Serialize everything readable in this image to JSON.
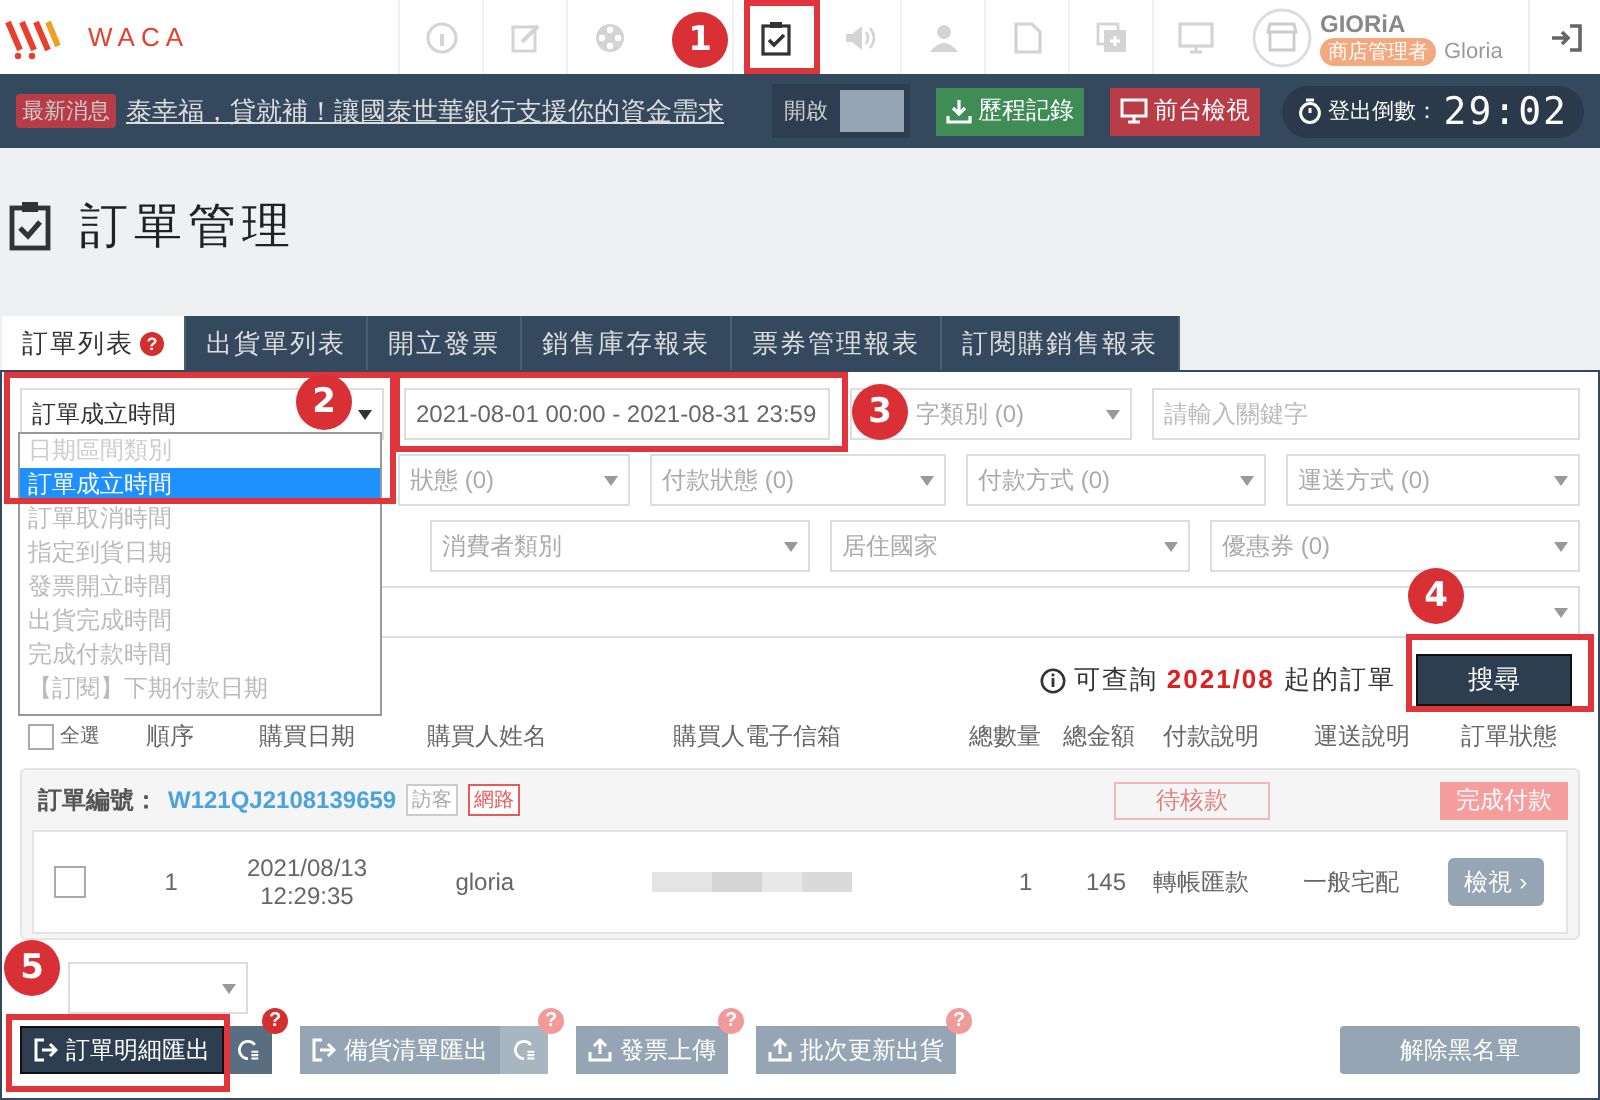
{
  "logo": {
    "text": "WACA"
  },
  "nav": [
    {
      "selected": false
    },
    {
      "selected": false
    },
    {
      "selected": false
    },
    {
      "selected": true
    },
    {
      "selected": false
    },
    {
      "selected": false
    },
    {
      "selected": false
    },
    {
      "selected": false
    },
    {
      "selected": false
    }
  ],
  "user": {
    "name": "GIORiA",
    "role": "商店管理者",
    "account": "Gloria"
  },
  "news": {
    "badge": "最新消息",
    "text": "泰幸福，貸就補！讓國泰世華銀行支援你的資金需求",
    "toggle_label": "開啟",
    "toggle_on": false,
    "history_button": "歷程記錄",
    "frontend_button": "前台檢視",
    "countdown_label": "登出倒數：",
    "countdown": "29:02"
  },
  "page_title": "訂單管理",
  "tabs": [
    {
      "label": "訂單列表",
      "selected": true,
      "help": "?"
    },
    {
      "label": "出貨單列表",
      "selected": false
    },
    {
      "label": "開立發票",
      "selected": false
    },
    {
      "label": "銷售庫存報表",
      "selected": false
    },
    {
      "label": "票券管理報表",
      "selected": false
    },
    {
      "label": "訂閱購銷售報表",
      "selected": false
    }
  ],
  "filters": {
    "date_type": "訂單成立時間",
    "date_range": "2021-08-01 00:00 - 2021-08-31 23:59",
    "keyword_type": "字類別 (0)",
    "keyword_placeholder": "請輸入關鍵字",
    "row2": [
      "狀態 (0)",
      "付款狀態 (0)",
      "付款方式 (0)",
      "運送方式 (0)"
    ],
    "row3": [
      "消費者類別",
      "居住國家",
      "優惠券 (0)"
    ]
  },
  "date_type_options": [
    {
      "label": "日期區間類別",
      "selected": false,
      "disabled": true
    },
    {
      "label": "訂單成立時間",
      "selected": true,
      "disabled": false
    },
    {
      "label": "訂單取消時間",
      "selected": false,
      "disabled": false
    },
    {
      "label": "指定到貨日期",
      "selected": false,
      "disabled": false
    },
    {
      "label": "發票開立時間",
      "selected": false,
      "disabled": false
    },
    {
      "label": "出貨完成時間",
      "selected": false,
      "disabled": false
    },
    {
      "label": "完成付款時間",
      "selected": false,
      "disabled": false
    },
    {
      "label": "【訂閱】下期付款日期",
      "selected": false,
      "disabled": false
    }
  ],
  "query_note": {
    "before": "可查詢",
    "month": "2021/08",
    "after": "起的訂單"
  },
  "search_button": "搜尋",
  "table": {
    "select_all": "全選",
    "select_all_checked": false,
    "columns": [
      "順序",
      "購買日期",
      "購買人姓名",
      "購買人電子信箱",
      "總數量",
      "總金額",
      "付款說明",
      "運送說明",
      "訂單狀態"
    ]
  },
  "orders": [
    {
      "number_label": "訂單編號：",
      "number": "W121QJ2108139659",
      "tags": [
        "訪客",
        "網路"
      ],
      "payment_review": "待核款",
      "status": "完成付款",
      "checked": false,
      "index": "1",
      "date": "2021/08/13",
      "time": "12:29:35",
      "buyer": "gloria",
      "quantity": "1",
      "amount": "145",
      "payment": "轉帳匯款",
      "shipping": "一般宅配",
      "view_button": "檢視 ›"
    }
  ],
  "actions": [
    {
      "label": "訂單明細匯出",
      "kind": "primary",
      "side": true,
      "help": "?"
    },
    {
      "label": "備貨清單匯出",
      "kind": "muted",
      "side": true,
      "help": "?"
    },
    {
      "label": "發票上傳",
      "kind": "upload",
      "side": false,
      "help": "?"
    },
    {
      "label": "批次更新出貨",
      "kind": "upload",
      "side": false,
      "help": "?"
    }
  ],
  "blacklist_button": "解除黑名單",
  "callouts": [
    "1",
    "2",
    "3",
    "4",
    "5"
  ]
}
